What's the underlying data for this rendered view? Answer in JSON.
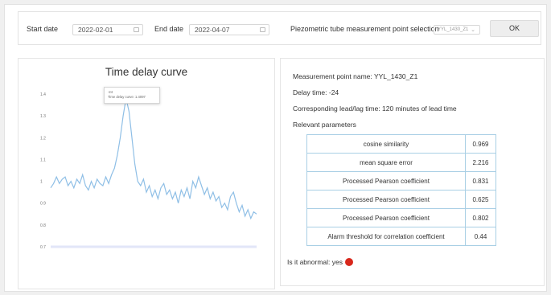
{
  "toolbar": {
    "start_label": "Start date",
    "start_value": "2022-02-01",
    "end_label": "End date",
    "end_value": "2022-04-07",
    "point_label": "Piezometric tube measurement point selection",
    "point_value": "YYL_1430_Z1",
    "ok_label": "OK"
  },
  "chart": {
    "title": "Time delay curve",
    "tooltip_line1": "-24",
    "tooltip_line2": "Time delay curve: 1.4097"
  },
  "chart_data": {
    "type": "line",
    "title": "Time delay curve",
    "ylim": [
      0.7,
      1.4
    ],
    "yticks": [
      "1.4",
      "1.3",
      "1.2",
      "1.1",
      "1",
      "0.9",
      "0.8",
      "0.7"
    ],
    "grid": false,
    "series": [
      {
        "color": "#8fbfe6",
        "values": [
          0.97,
          0.99,
          1.02,
          0.99,
          1.01,
          1.02,
          0.98,
          1.0,
          0.97,
          1.01,
          0.99,
          1.03,
          0.98,
          0.96,
          1.0,
          0.97,
          1.01,
          0.99,
          0.98,
          1.02,
          0.99,
          1.03,
          1.06,
          1.12,
          1.2,
          1.3,
          1.38,
          1.32,
          1.2,
          1.08,
          1.0,
          0.98,
          1.01,
          0.95,
          0.98,
          0.93,
          0.96,
          0.92,
          0.97,
          0.99,
          0.94,
          0.96,
          0.92,
          0.95,
          0.9,
          0.96,
          0.93,
          0.97,
          0.92,
          1.0,
          0.97,
          1.02,
          0.98,
          0.94,
          0.97,
          0.92,
          0.95,
          0.91,
          0.93,
          0.88,
          0.9,
          0.87,
          0.93,
          0.95,
          0.9,
          0.86,
          0.89,
          0.84,
          0.87,
          0.83,
          0.86,
          0.85
        ]
      }
    ]
  },
  "info": {
    "name_line": "Measurement point name: YYL_1430_Z1",
    "delay_line": "Delay time: -24",
    "lead_line": "Corresponding lead/lag time: 120 minutes of lead time",
    "params_heading": "Relevant parameters",
    "params": [
      {
        "name": "cosine similarity",
        "value": "0.969"
      },
      {
        "name": "mean square error",
        "value": "2.216"
      },
      {
        "name": "Processed Pearson coefficient",
        "value": "0.831"
      },
      {
        "name": "Processed Pearson coefficient",
        "value": "0.625"
      },
      {
        "name": "Processed Pearson coefficient",
        "value": "0.802"
      },
      {
        "name": "Alarm threshold for correlation coefficient",
        "value": "0.44"
      }
    ],
    "abnormal_line": "Is it abnormal: yes",
    "abnormal_color": "#d8281c"
  }
}
